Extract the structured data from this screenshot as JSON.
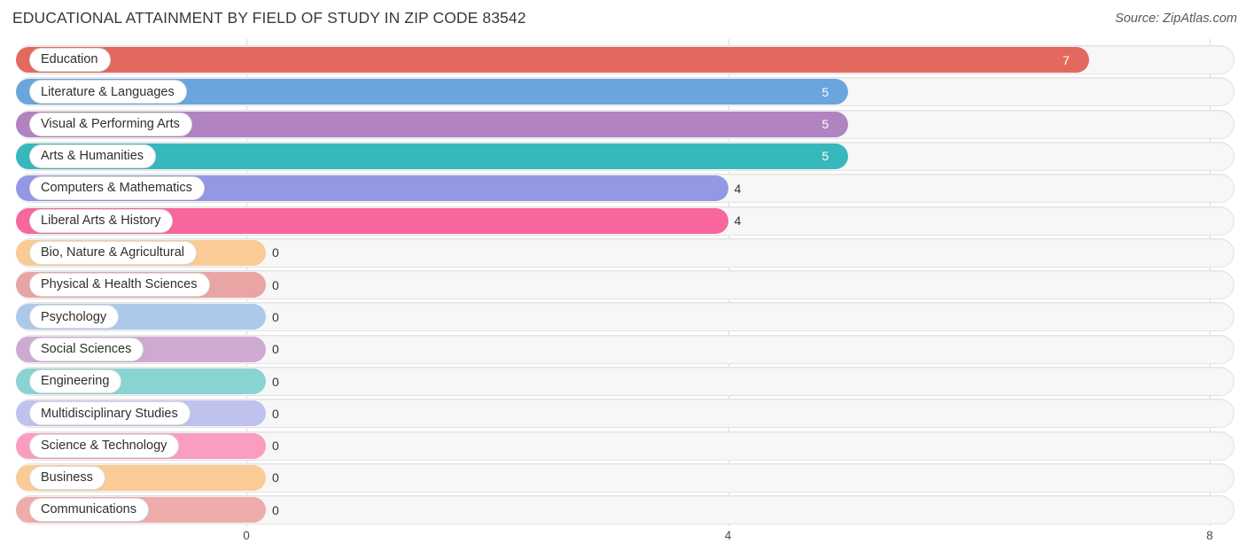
{
  "header": {
    "title": "EDUCATIONAL ATTAINMENT BY FIELD OF STUDY IN ZIP CODE 83542",
    "source": "Source: ZipAtlas.com"
  },
  "chart_data": {
    "type": "bar",
    "orientation": "horizontal",
    "title": "EDUCATIONAL ATTAINMENT BY FIELD OF STUDY IN ZIP CODE 83542",
    "xlabel": "",
    "ylabel": "",
    "xlim": [
      0,
      8
    ],
    "ticks": [
      "0",
      "4",
      "8"
    ],
    "tick_values": [
      0,
      4,
      8
    ],
    "grid": true,
    "legend": null,
    "categories": [
      "Education",
      "Literature & Languages",
      "Visual & Performing Arts",
      "Arts & Humanities",
      "Computers & Mathematics",
      "Liberal Arts & History",
      "Bio, Nature & Agricultural",
      "Physical & Health Sciences",
      "Psychology",
      "Social Sciences",
      "Engineering",
      "Multidisciplinary Studies",
      "Science & Technology",
      "Business",
      "Communications"
    ],
    "values": [
      7,
      5,
      5,
      5,
      4,
      4,
      0,
      0,
      0,
      0,
      0,
      0,
      0,
      0,
      0
    ],
    "value_labels": [
      "7",
      "5",
      "5",
      "5",
      "4",
      "4",
      "0",
      "0",
      "0",
      "0",
      "0",
      "0",
      "0",
      "0",
      "0"
    ],
    "colors": [
      "#e3695f",
      "#6aa5de",
      "#b183c0",
      "#37b8bd",
      "#9298e4",
      "#f7679e",
      "#fbcb96",
      "#e8a5a3",
      "#adc9ea",
      "#ceaad3",
      "#88d4d2",
      "#bec2ed",
      "#fa9dc0",
      "#fbcb96",
      "#eeacaa"
    ]
  },
  "axis": {
    "ticks": [
      "0",
      "4",
      "8"
    ]
  }
}
